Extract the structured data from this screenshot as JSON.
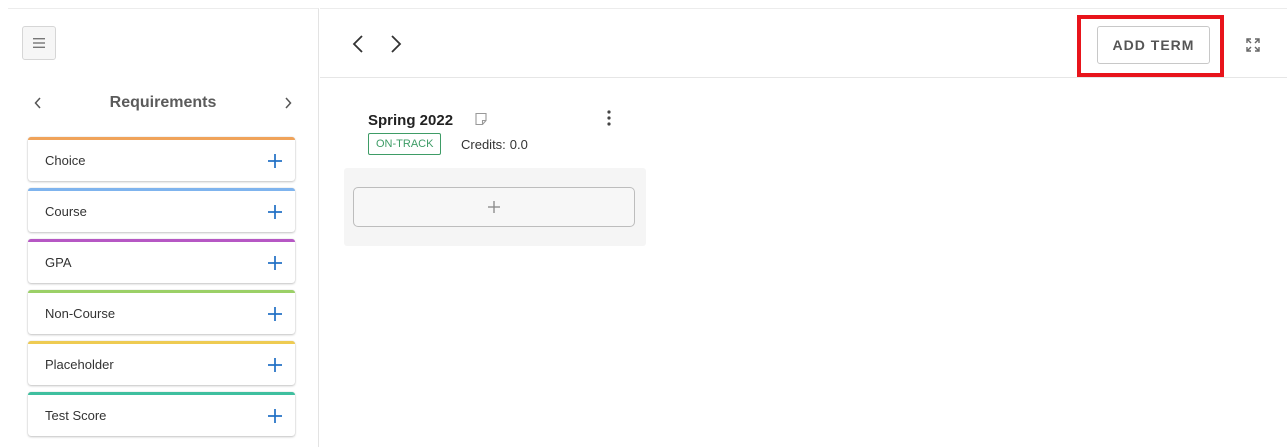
{
  "sidebar": {
    "title": "Requirements",
    "items": [
      {
        "label": "Choice",
        "color": "#f0a35a"
      },
      {
        "label": "Course",
        "color": "#7fb4ee"
      },
      {
        "label": "GPA",
        "color": "#b657c4"
      },
      {
        "label": "Non-Course",
        "color": "#9bd067"
      },
      {
        "label": "Placeholder",
        "color": "#eecb52"
      },
      {
        "label": "Test Score",
        "color": "#3fbf9f"
      }
    ],
    "icons": {
      "menu": "hamburger-menu-icon",
      "prev": "chevron-left-icon",
      "next": "chevron-right-icon",
      "add": "plus-icon"
    }
  },
  "toolbar": {
    "add_term_label": "ADD TERM",
    "highlight_color": "#e8141b",
    "icons": {
      "prev": "chevron-left-icon",
      "next": "chevron-right-icon",
      "expand": "expand-icon"
    }
  },
  "term": {
    "name": "Spring 2022",
    "status": "ON-TRACK",
    "status_color": "#3e9c66",
    "credits_label": "Credits:",
    "credits_value": "0.0",
    "icons": {
      "note": "note-icon",
      "menu": "kebab-menu-icon",
      "add": "plus-icon"
    }
  },
  "colors": {
    "accent_blue": "#1f6fc4"
  }
}
